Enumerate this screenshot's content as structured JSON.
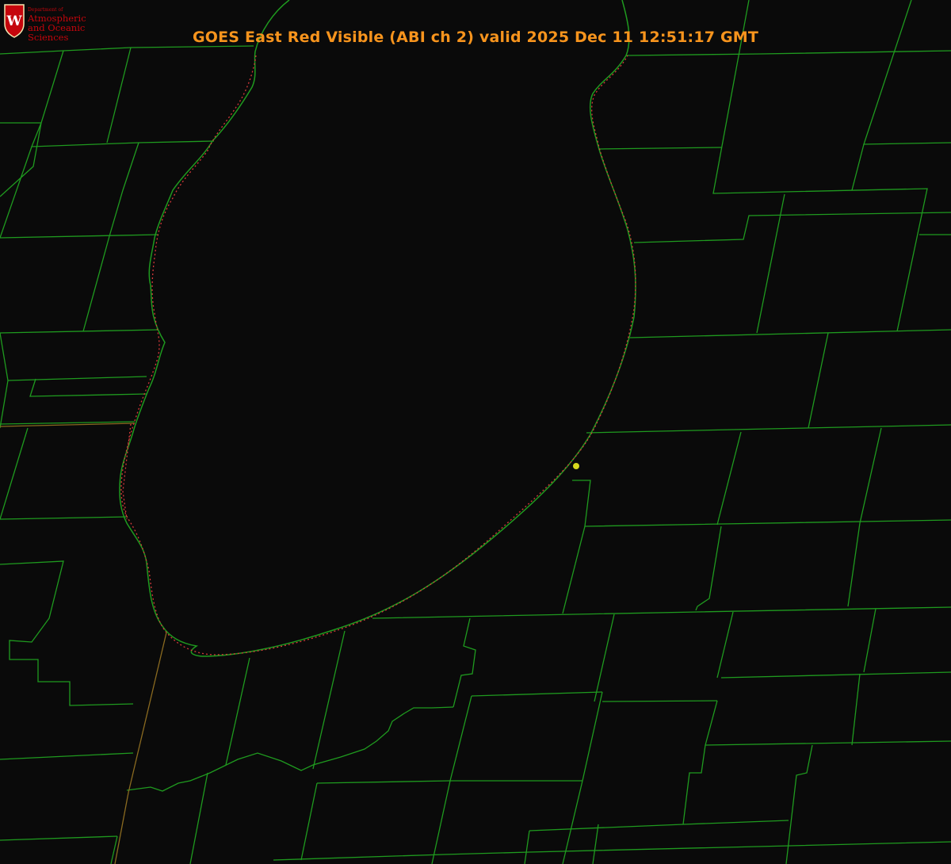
{
  "title": "GOES East Red Visible (ABI ch 2) valid 2025 Dec 11 12:51:17 GMT",
  "logo": {
    "letter": "W",
    "department": "Department of",
    "line1": "Atmospheric",
    "line2": "and Oceanic Sciences"
  },
  "colors": {
    "background": "#0a0a0a",
    "boundary": "#1f9a1f",
    "coastline_dots": "#d43a3a",
    "title": "#f7941d",
    "marker": "#d8d81e",
    "logo": "#c5050c"
  }
}
